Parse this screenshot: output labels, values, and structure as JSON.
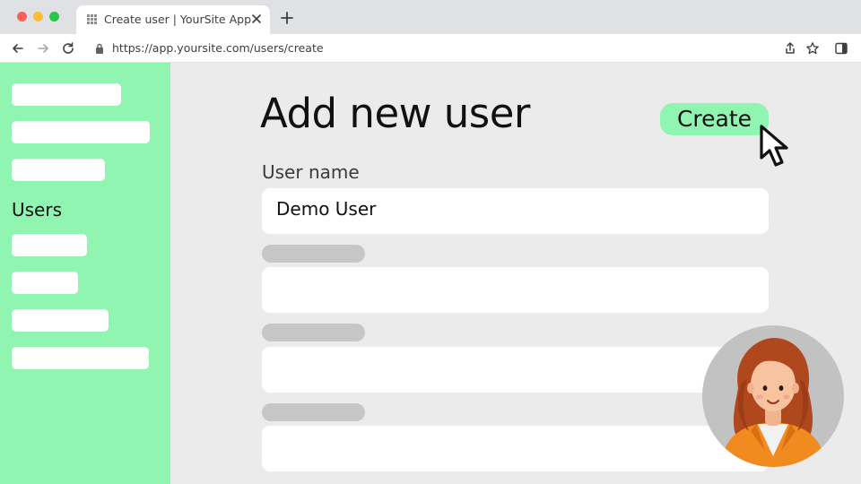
{
  "browser": {
    "tab_title": "Create user | YourSite App",
    "url": "https://app.yoursite.com/users/create"
  },
  "sidebar": {
    "active_label": "Users"
  },
  "main": {
    "title": "Add new user",
    "create_button": "Create",
    "fields": [
      {
        "label": "User name",
        "value": "Demo User"
      }
    ]
  },
  "colors": {
    "accent": "#8ff5b0",
    "background": "#ebebeb",
    "field": "#ffffff",
    "placeholder": "#c6c6c6"
  },
  "icons": [
    "apps-grid-icon",
    "close-icon",
    "plus-icon",
    "back-arrow-icon",
    "forward-arrow-icon",
    "reload-icon",
    "lock-icon",
    "share-icon",
    "star-icon",
    "sidebar-toggle-icon",
    "mouse-pointer-icon"
  ]
}
